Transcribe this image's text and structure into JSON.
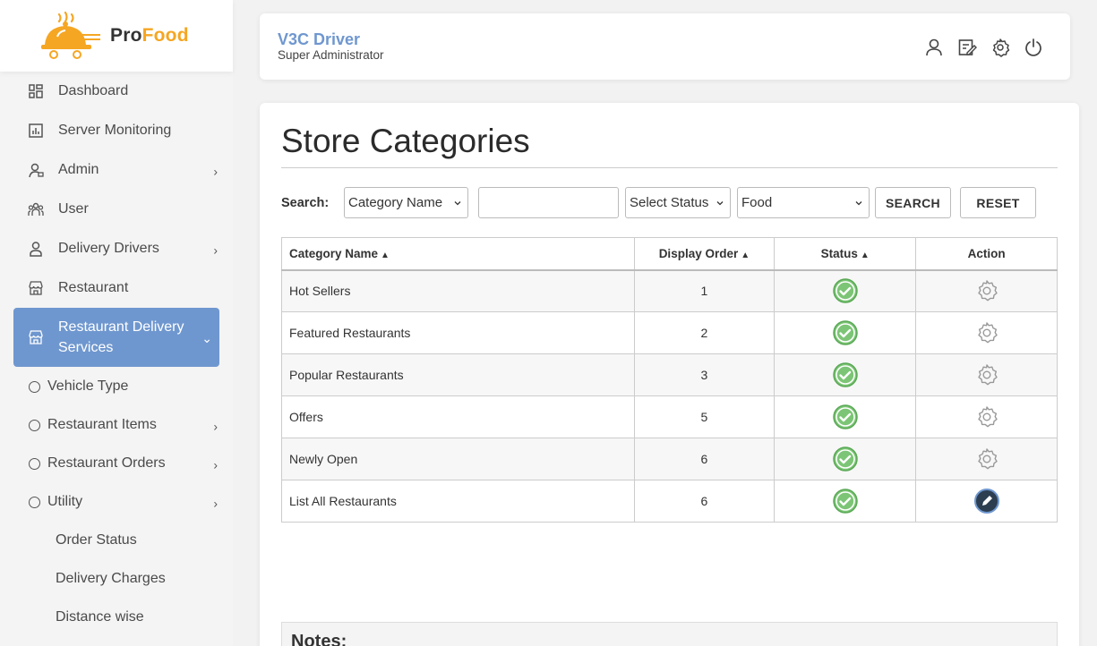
{
  "brand": {
    "part1": "Pro",
    "part2": "Food"
  },
  "header": {
    "name": "V3C Driver",
    "role": "Super Administrator"
  },
  "sidebar": {
    "items": [
      {
        "label": "Dashboard",
        "icon": "dashboard-icon"
      },
      {
        "label": "Server Monitoring",
        "icon": "chart-icon"
      },
      {
        "label": "Admin",
        "icon": "admin-icon",
        "has_children": true
      },
      {
        "label": "User",
        "icon": "users-icon"
      },
      {
        "label": "Delivery Drivers",
        "icon": "driver-icon",
        "has_children": true
      },
      {
        "label": "Restaurant",
        "icon": "store-icon"
      },
      {
        "label": "Restaurant Delivery Services",
        "icon": "store-icon",
        "active": true
      }
    ],
    "subitems": [
      {
        "label": "Vehicle Type"
      },
      {
        "label": "Restaurant Items",
        "has_children": true
      },
      {
        "label": "Restaurant Orders",
        "has_children": true
      },
      {
        "label": "Utility",
        "has_children": true
      }
    ],
    "utility_children": [
      "Order Status",
      "Delivery Charges",
      "Distance wise"
    ]
  },
  "main": {
    "title": "Store Categories",
    "search": {
      "label": "Search:",
      "field_select": "Category Name",
      "text_value": "",
      "status_select": "Select Status",
      "type_select": "Food",
      "search_button": "SEARCH",
      "reset_button": "RESET"
    },
    "table": {
      "headers": [
        "Category Name",
        "Display Order",
        "Status",
        "Action"
      ],
      "rows": [
        {
          "name": "Hot Sellers",
          "order": "1",
          "status": "active",
          "action": "settings"
        },
        {
          "name": "Featured Restaurants",
          "order": "2",
          "status": "active",
          "action": "settings"
        },
        {
          "name": "Popular Restaurants",
          "order": "3",
          "status": "active",
          "action": "settings"
        },
        {
          "name": "Offers",
          "order": "5",
          "status": "active",
          "action": "settings"
        },
        {
          "name": "Newly Open",
          "order": "6",
          "status": "active",
          "action": "settings"
        },
        {
          "name": "List All Restaurants",
          "order": "6",
          "status": "active",
          "action": "edit"
        }
      ]
    },
    "notes_title": "Notes:"
  },
  "colors": {
    "accent": "#6f97cf",
    "brand": "#f5a623",
    "status_ok": "#7cc576",
    "edit_button": "#2c3e50"
  }
}
